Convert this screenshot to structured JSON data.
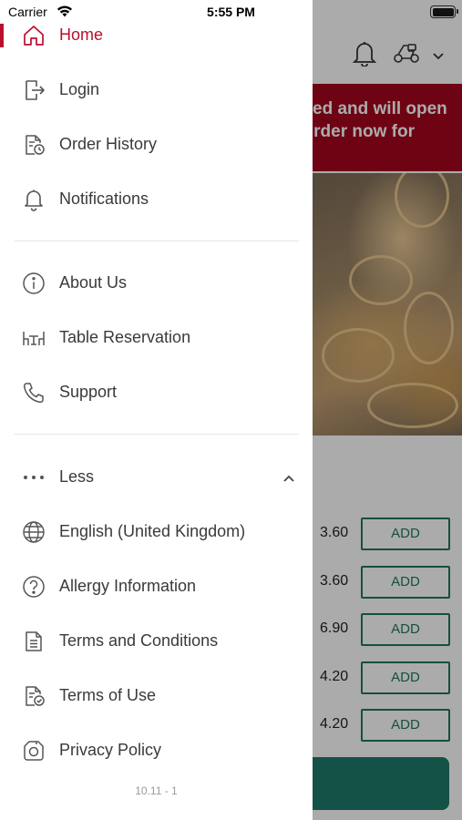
{
  "status_bar": {
    "carrier": "Carrier",
    "time": "5:55 PM"
  },
  "menu": {
    "primary": [
      {
        "label": "Home",
        "icon": "home-icon",
        "active": true
      },
      {
        "label": "Login",
        "icon": "login-icon"
      },
      {
        "label": "Order History",
        "icon": "order-history-icon"
      },
      {
        "label": "Notifications",
        "icon": "bell-icon"
      }
    ],
    "secondary": [
      {
        "label": "About Us",
        "icon": "info-icon"
      },
      {
        "label": "Table Reservation",
        "icon": "table-reservation-icon"
      },
      {
        "label": "Support",
        "icon": "phone-icon"
      }
    ],
    "more": {
      "label": "Less",
      "icon": "more-dots-icon"
    },
    "tertiary": [
      {
        "label": "English (United Kingdom)",
        "icon": "globe-icon"
      },
      {
        "label": "Allergy Information",
        "icon": "question-icon"
      },
      {
        "label": "Terms and Conditions",
        "icon": "document-icon"
      },
      {
        "label": "Terms of Use",
        "icon": "document-check-icon"
      },
      {
        "label": "Privacy Policy",
        "icon": "privacy-icon"
      }
    ],
    "version": "10.11 - 1"
  },
  "background": {
    "banner_lines": [
      "ed and will open",
      "rder now for"
    ],
    "items": [
      {
        "price": "3.60",
        "button": "ADD"
      },
      {
        "price": "3.60",
        "button": "ADD"
      },
      {
        "price": "6.90",
        "button": "ADD"
      },
      {
        "price": "4.20",
        "button": "ADD"
      },
      {
        "price": "4.20",
        "button": "ADD"
      }
    ]
  },
  "colors": {
    "accent": "#b8102e",
    "banner": "#a4051f",
    "add_green": "#1f7a55"
  }
}
